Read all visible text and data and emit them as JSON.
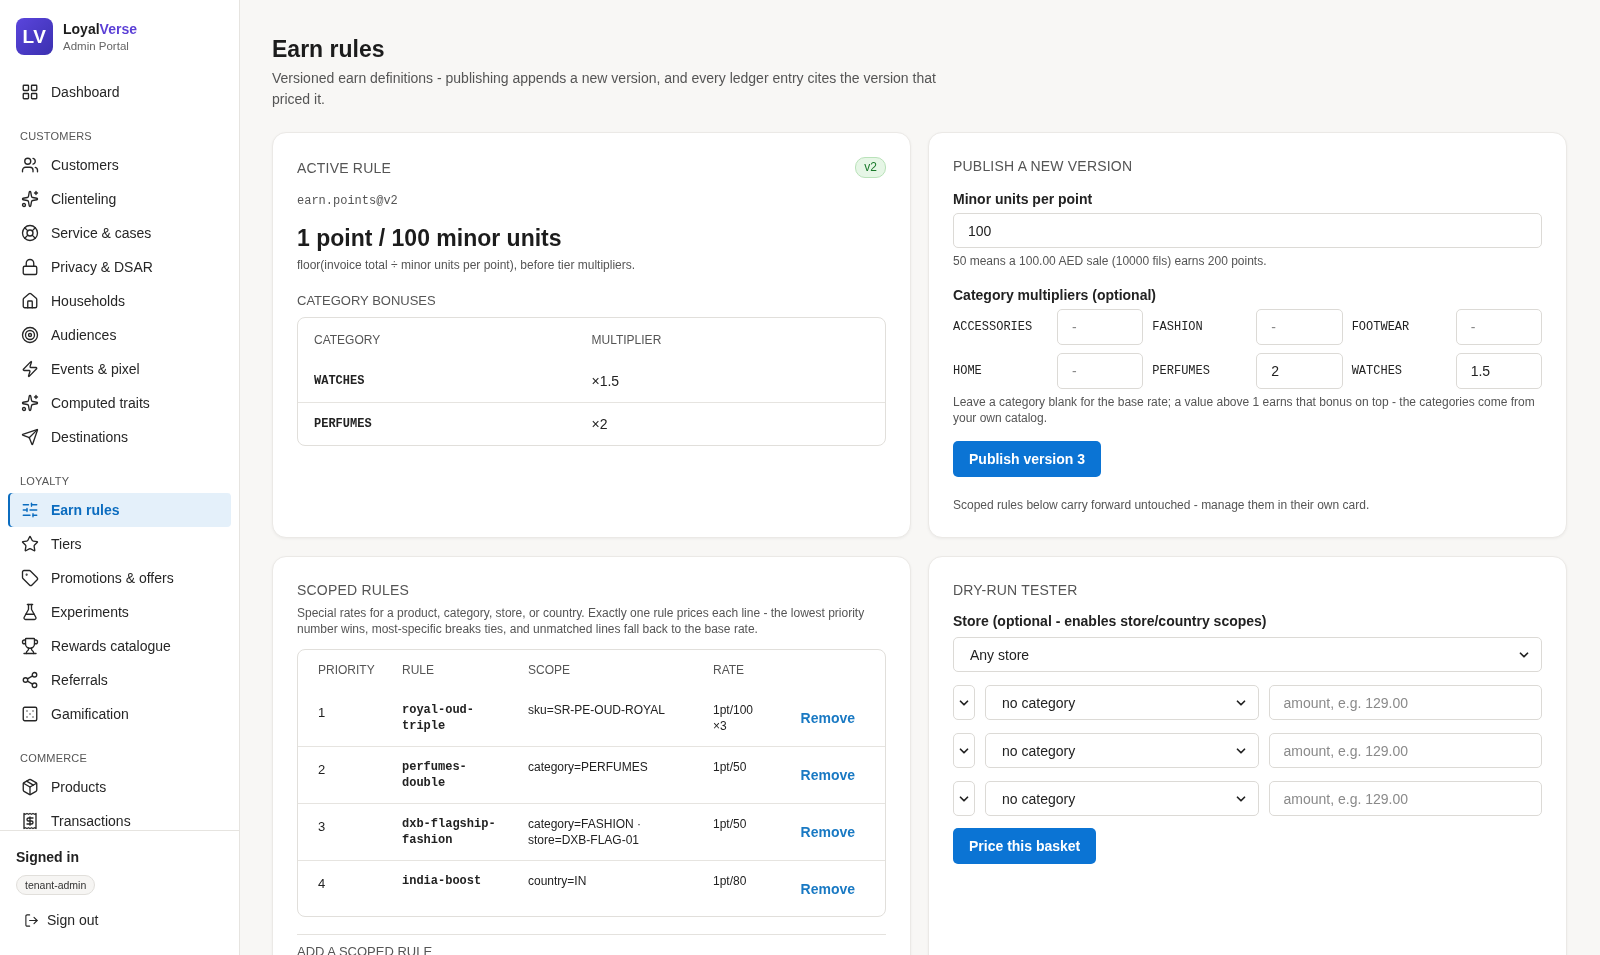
{
  "sidebar": {
    "brand": {
      "logo_text": "LV",
      "name": "Loyal",
      "name_accent": "Verse",
      "subtitle": "Admin Portal"
    },
    "nav": [
      {
        "items": [
          {
            "label": "Dashboard",
            "selected": false
          }
        ]
      },
      {
        "title": "CUSTOMERS",
        "items": [
          {
            "label": "Customers",
            "selected": false
          },
          {
            "label": "Clienteling",
            "selected": false
          },
          {
            "label": "Service & cases",
            "selected": false
          },
          {
            "label": "Privacy & DSAR",
            "selected": false
          },
          {
            "label": "Households",
            "selected": false
          },
          {
            "label": "Audiences",
            "selected": false
          },
          {
            "label": "Events & pixel",
            "selected": false
          },
          {
            "label": "Computed traits",
            "selected": false
          },
          {
            "label": "Destinations",
            "selected": false
          }
        ]
      },
      {
        "title": "LOYALTY",
        "items": [
          {
            "label": "Earn rules",
            "selected": true
          },
          {
            "label": "Tiers",
            "selected": false
          },
          {
            "label": "Promotions & offers",
            "selected": false
          },
          {
            "label": "Experiments",
            "selected": false
          },
          {
            "label": "Rewards catalogue",
            "selected": false
          },
          {
            "label": "Referrals",
            "selected": false
          },
          {
            "label": "Gamification",
            "selected": false
          }
        ]
      },
      {
        "title": "COMMERCE",
        "items": [
          {
            "label": "Products",
            "selected": false
          },
          {
            "label": "Transactions",
            "selected": false
          }
        ]
      }
    ],
    "account": {
      "heading": "Signed in",
      "role": "tenant-admin",
      "sign_out": "Sign out"
    }
  },
  "page": {
    "title": "Earn rules",
    "subtitle": "Versioned earn definitions - publishing appends a new version, and every ledger entry cites the version that priced it."
  },
  "active_rule": {
    "heading": "ACTIVE RULE",
    "version_badge": "v2",
    "rule_id": "earn.points@v2",
    "rate": "1 point / 100 minor units",
    "formula": "floor(invoice total ÷ minor units per point), before tier multipliers.",
    "bonuses_heading": "CATEGORY BONUSES",
    "bonuses_table": {
      "columns": [
        "CATEGORY",
        "MULTIPLIER"
      ],
      "rows": [
        [
          "WATCHES",
          "×1.5"
        ],
        [
          "PERFUMES",
          "×2"
        ]
      ]
    }
  },
  "publish": {
    "heading": "PUBLISH A NEW VERSION",
    "minor_units_label": "Minor units per point",
    "minor_units_value": "100",
    "minor_units_hint": "50 means a 100.00 AED sale (10000 fils) earns 200 points.",
    "multipliers_label": "Category multipliers (optional)",
    "multipliers": [
      {
        "category": "ACCESSORIES",
        "placeholder": "-"
      },
      {
        "category": "FASHION",
        "placeholder": "-"
      },
      {
        "category": "FOOTWEAR",
        "placeholder": "-"
      },
      {
        "category": "HOME",
        "placeholder": "-"
      },
      {
        "category": "PERFUMES",
        "value": "2"
      },
      {
        "category": "WATCHES",
        "value": "1.5"
      }
    ],
    "multipliers_hint": "Leave a category blank for the base rate; a value above 1 earns that bonus on top - the categories come from your own catalog.",
    "button": "Publish version 3",
    "footer_note": "Scoped rules below carry forward untouched - manage them in their own card."
  },
  "scoped_rules": {
    "heading": "SCOPED RULES",
    "description": "Special rates for a product, category, store, or country. Exactly one rule prices each line - the lowest priority number wins, most-specific breaks ties, and unmatched lines fall back to the base rate.",
    "columns": [
      "PRIORITY",
      "RULE",
      "SCOPE",
      "RATE"
    ],
    "rows": [
      {
        "priority": "1",
        "rule": "royal-oud-triple",
        "scope": "sku=SR-PE-OUD-ROYAL",
        "rate": "1pt/100 ×3",
        "action": "Remove"
      },
      {
        "priority": "2",
        "rule": "perfumes-double",
        "scope": "category=PERFUMES",
        "rate": "1pt/50",
        "action": "Remove"
      },
      {
        "priority": "3",
        "rule": "dxb-flagship-fashion",
        "scope": "category=FASHION · store=DXB-FLAG-01",
        "rate": "1pt/50",
        "action": "Remove"
      },
      {
        "priority": "4",
        "rule": "india-boost",
        "scope": "country=IN",
        "rate": "1pt/80",
        "action": "Remove"
      }
    ],
    "add_heading": "ADD A SCOPED RULE"
  },
  "dry_run": {
    "heading": "DRY-RUN TESTER",
    "store_label": "Store (optional - enables store/country scopes)",
    "store_value": "Any store",
    "lines": [
      {
        "category": "no category",
        "amount_placeholder": "amount, e.g. 129.00"
      },
      {
        "category": "no category",
        "amount_placeholder": "amount, e.g. 129.00"
      },
      {
        "category": "no category",
        "amount_placeholder": "amount, e.g. 129.00"
      }
    ],
    "button": "Price this basket"
  }
}
